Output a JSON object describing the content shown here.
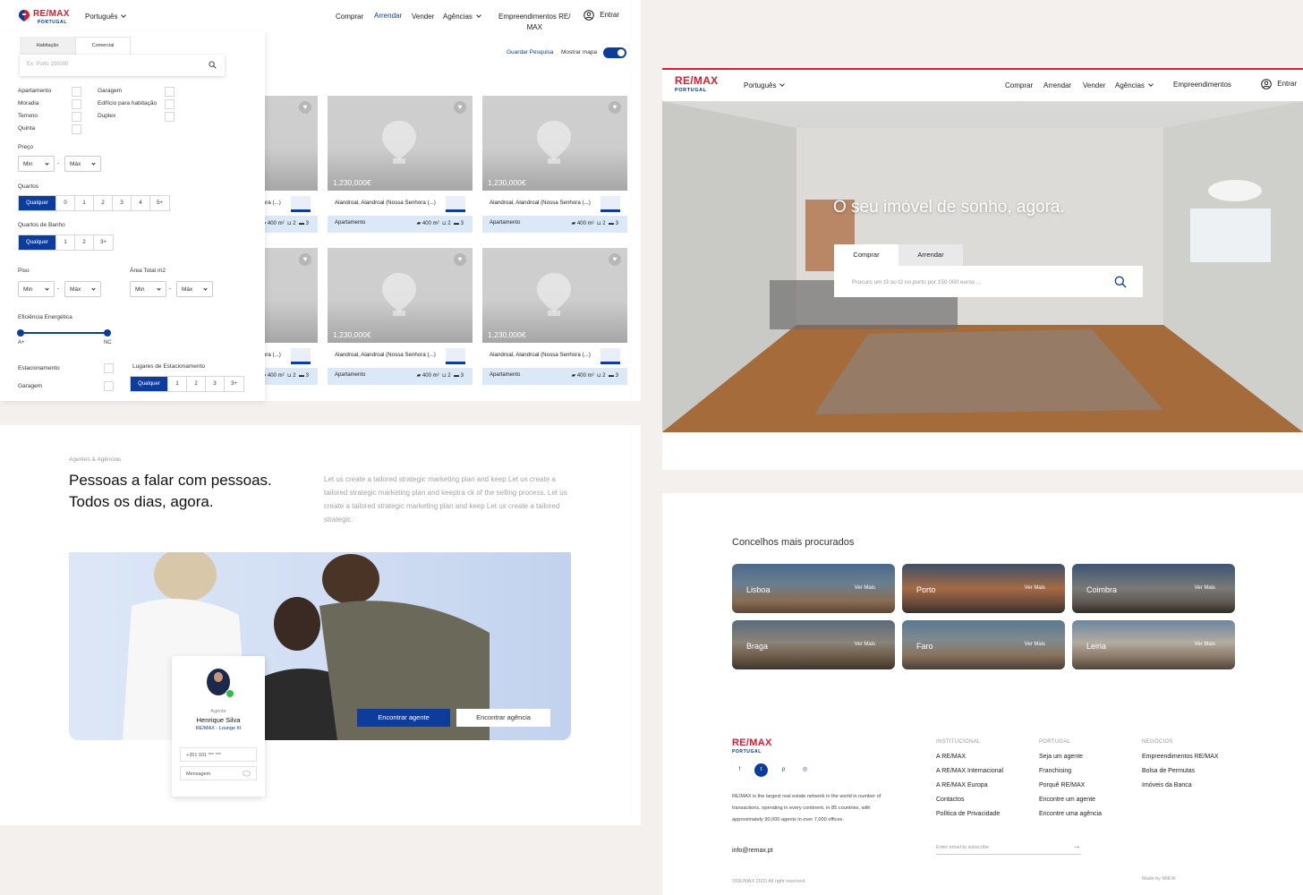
{
  "search_page": {
    "brand": "RE/MAX",
    "brand_sub": "PORTUGAL",
    "language": "Português",
    "nav": [
      "Comprar",
      "Arrendar",
      "Vender",
      "Agências"
    ],
    "nav_extra": "Empreendimentos RE/\nMAX",
    "login": "Entrar",
    "tabs": [
      "Habitação",
      "Comercial"
    ],
    "search_placeholder": "Ex: Porto 150000",
    "save_search": "Guardar Pesquisa",
    "show_map": "Mostrar mapa",
    "types_left": [
      "Apartamento",
      "Moradia",
      "Terreno",
      "Quinta"
    ],
    "types_right": [
      "Garagem",
      "Edifício para habitação",
      "Duplex"
    ],
    "price_label": "Preço",
    "min": "Min",
    "max": "Máx",
    "rooms_label": "Quartos",
    "rooms_opts": [
      "Qualquer",
      "0",
      "1",
      "2",
      "3",
      "4",
      "5+"
    ],
    "baths_label": "Quartos de Banho",
    "baths_opts": [
      "Qualquer",
      "1",
      "2",
      "3+"
    ],
    "floor_label": "Piso",
    "area_label": "Área Total m2",
    "energy_label": "Eficiência Energética",
    "energy_min": "A+",
    "energy_max": "NC",
    "parking_label": "Estacionamento",
    "garage_label": "Garagem",
    "parking_spaces_label": "Lugares de Estacionamento",
    "parking_opts": [
      "Qualquer",
      "1",
      "2",
      "3",
      "3+"
    ],
    "listing": {
      "price": "1,230,000€",
      "location": "Alandroal, Alandroal (Nossa Senhora (...)",
      "type": "Apartamento",
      "area": "400 m²",
      "baths": "2",
      "beds": "3"
    }
  },
  "home": {
    "language": "Português",
    "nav": [
      "Comprar",
      "Arrendar",
      "Vender",
      "Agências"
    ],
    "nav_extra": "Empreendimentos",
    "login": "Entrar",
    "hero_title": "O seu imóvel de sonho, agora.",
    "tabs": [
      "Comprar",
      "Arrendar"
    ],
    "search_placeholder": "Procuro um t3 ou t2 no porto por 150 000 euros ..."
  },
  "agents": {
    "eyebrow": "Agentes & Agências",
    "title_1": "Pessoas a falar com pessoas.",
    "title_2": "Todos os dias, agora.",
    "body": "Let us create a tailored strategic marketing plan and keep Let us create a tailored strategic marketing plan and keeptra ck of the selling process. Let us create a tailored strategic marketing plan and keep Let us create a tailored strategic.",
    "agent_role": "Agente",
    "agent_name": "Henrique Silva",
    "agent_office": "RE/MAX - Lounge III",
    "phone": "+351 931 *** ***",
    "message_placeholder": "Mensagem",
    "btn_agent": "Encontrar agente",
    "btn_agency": "Encontrar agência"
  },
  "cities": {
    "title": "Concelhos mais procurados",
    "more": "Ver Mais",
    "items": [
      "Lisboa",
      "Porto",
      "Coimbra",
      "Braga",
      "Faro",
      "Leiria"
    ]
  },
  "footer": {
    "about": "RE/MAX is the largest real estate network in the world in number of transactions, operating in every continent, in 85 countries, with approximately 90,000 agents in over 7,000 offices.",
    "email": "info@remax.pt",
    "col1_title": "INSTITUCIONAL",
    "col1": [
      "A RE/MAX",
      "A RE/MAX Internacional",
      "A RE/MAX Europa",
      "Contactos",
      "Política de Privacidade"
    ],
    "col2_title": "PORTUGAL",
    "col2": [
      "Seja um agente",
      "Franchising",
      "Porquê RE/MAX",
      "Encontre um agente",
      "Encontre uma agência"
    ],
    "col3_title": "NEGÓCIOS",
    "col3": [
      "Empreendimentos RE/MAX",
      "Bolsa de Permutas",
      "Imóveis da Banca"
    ],
    "subscribe_placeholder": "Enter email to subscribe",
    "copyright": "©RE/MAX 2020 All right reserved.",
    "made_by": "Made by MIEW"
  },
  "colors": {
    "brand_red": "#dc1c2e",
    "brand_blue": "#0c3d9c"
  }
}
